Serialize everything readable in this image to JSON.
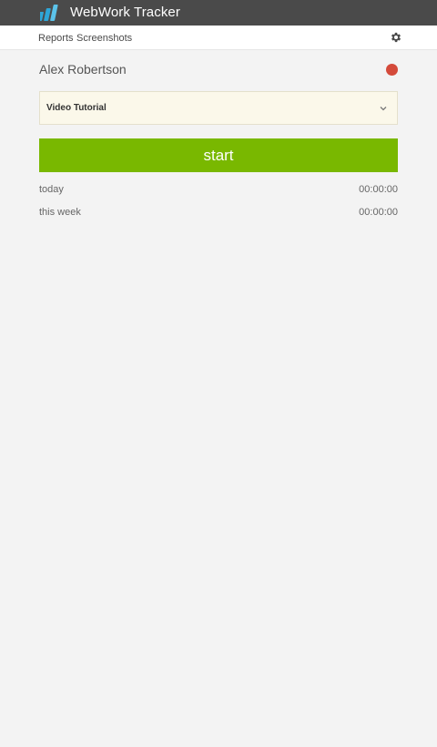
{
  "app": {
    "title": "WebWork Tracker",
    "logo_icon": "webwork-logo-icon",
    "logo_color": "#2ea6d8"
  },
  "nav": {
    "reports_label": "Reports",
    "screenshots_label": "Screenshots",
    "settings_icon": "gear-icon"
  },
  "user": {
    "name": "Alex Robertson",
    "status_color": "#d44a3a"
  },
  "project": {
    "selected": "Video Tutorial",
    "dropdown_icon": "chevron-down-icon"
  },
  "actions": {
    "start_label": "start",
    "start_color": "#79b800"
  },
  "stats": {
    "today_label": "today",
    "today_value": "00:00:00",
    "week_label": "this week",
    "week_value": "00:00:00"
  }
}
